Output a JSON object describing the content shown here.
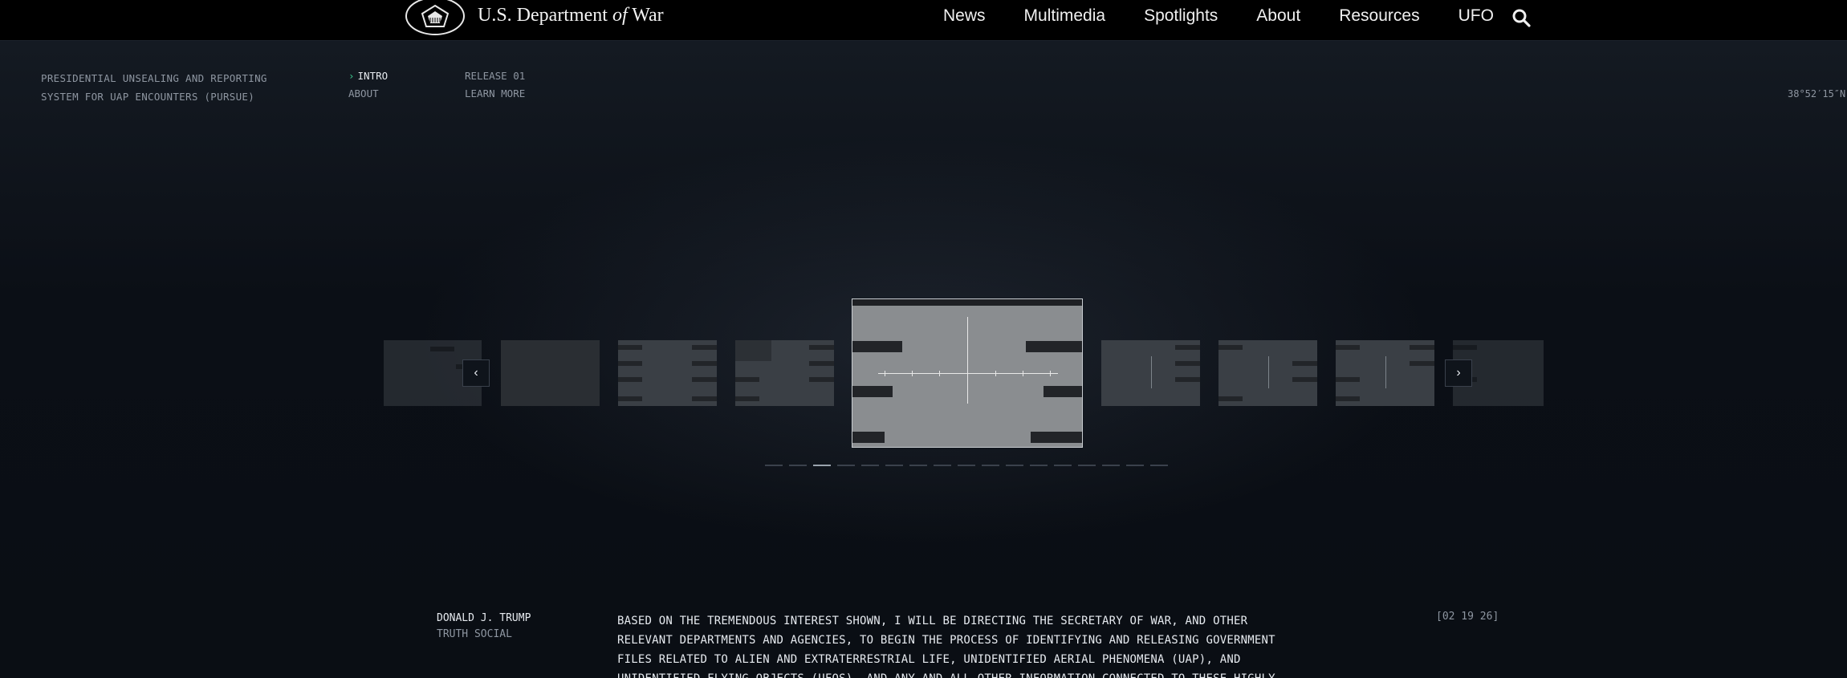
{
  "header": {
    "brand_prefix": "U.S. Department ",
    "brand_italic": "of",
    "brand_suffix": " War",
    "nav": [
      "News",
      "Multimedia",
      "Spotlights",
      "About",
      "Resources",
      "UFO"
    ]
  },
  "subheader": {
    "program_line1": "PRESIDENTIAL UNSEALING AND REPORTING",
    "program_line2": "SYSTEM FOR UAP ENCOUNTERS (PURSUE)",
    "nav_col1": [
      "INTRO",
      "ABOUT"
    ],
    "nav_col2": [
      "RELEASE 01",
      "LEARN MORE"
    ],
    "active_item": "INTRO",
    "coordinates": "38°52′15″N"
  },
  "carousel": {
    "prev_label": "‹",
    "next_label": "›",
    "slide_count": 17,
    "active_index": 2
  },
  "quote": {
    "author": "DONALD J. TRUMP",
    "source": "TRUTH SOCIAL",
    "text": "BASED ON THE TREMENDOUS INTEREST SHOWN, I WILL BE DIRECTING THE SECRETARY OF WAR, AND OTHER RELEVANT DEPARTMENTS AND AGENCIES, TO BEGIN THE PROCESS OF IDENTIFYING AND RELEASING GOVERNMENT FILES RELATED TO ALIEN AND EXTRATERRESTRIAL LIFE, UNIDENTIFIED AERIAL PHENOMENA (UAP), AND UNIDENTIFIED FLYING OBJECTS (UFOS), AND ANY AND ALL OTHER INFORMATION CONNECTED TO THESE HIGHLY",
    "timestamp": "[02 19 26]"
  },
  "colors": {
    "background": "#0b0f16",
    "accent_chevron": "#3ec98f",
    "muted_text": "#8e96a1"
  }
}
